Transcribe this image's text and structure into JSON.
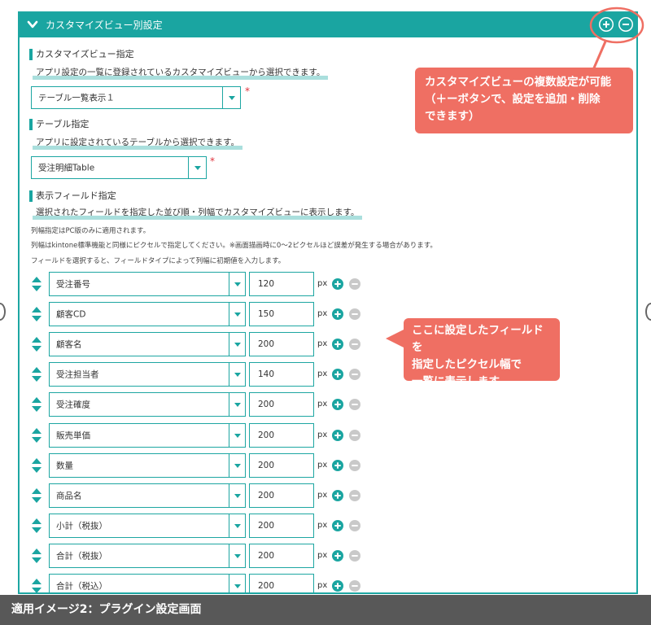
{
  "header": {
    "title": "カスタマイズビュー別設定"
  },
  "customize_view": {
    "title": "カスタマイズビュー指定",
    "description": "アプリ設定の一覧に登録されているカスタマイズビューから選択できます。",
    "selected": "テーブル一覧表示１",
    "required_mark": "*"
  },
  "table": {
    "title": "テーブル指定",
    "description": "アプリに設定されているテーブルから選択できます。",
    "selected": "受注明細Table",
    "required_mark": "*"
  },
  "fields": {
    "title": "表示フィールド指定",
    "description": "選択されたフィールドを指定した並び順・列幅でカスタマイズビューに表示します。",
    "notes": [
      "列幅指定はPC版のみに適用されます。",
      "列幅はkintone標準機能と同様にピクセルで指定してください。※画面描画時に0～2ピクセルほど誤差が発生する場合があります。",
      "フィールドを選択すると、フィールドタイプによって列幅に初期値を入力します。"
    ],
    "unit": "px",
    "rows": [
      {
        "field": "受注番号",
        "width": "120"
      },
      {
        "field": "顧客CD",
        "width": "150"
      },
      {
        "field": "顧客名",
        "width": "200"
      },
      {
        "field": "受注担当者",
        "width": "140"
      },
      {
        "field": "受注確度",
        "width": "200"
      },
      {
        "field": "販売単価",
        "width": "200"
      },
      {
        "field": "数量",
        "width": "200"
      },
      {
        "field": "商品名",
        "width": "200"
      },
      {
        "field": "小計（税抜）",
        "width": "200"
      },
      {
        "field": "合計（税抜）",
        "width": "200"
      },
      {
        "field": "合計（税込）",
        "width": "200"
      }
    ]
  },
  "callouts": {
    "multi_setting": [
      "カスタマイズビューの複数設定が可能",
      "（＋ーボタンで、設定を追加・削除",
      "できます）"
    ],
    "pixel_width": [
      "ここに設定したフィールドを",
      "指定したピクセル幅で",
      "一覧に表示します"
    ]
  },
  "caption": "適用イメージ2：プラグイン設定画面",
  "colors": {
    "accent": "#1aa5a1",
    "highlight": "#8ed4d2",
    "callout": "#ef6f63",
    "required": "#e0333d",
    "caption_bg": "#585858"
  },
  "icons": {
    "collapse": "chevron-down-icon",
    "add": "plus-circle-icon",
    "remove": "minus-circle-icon",
    "sort": "sort-handle-icon",
    "dropdown": "caret-down-icon"
  }
}
